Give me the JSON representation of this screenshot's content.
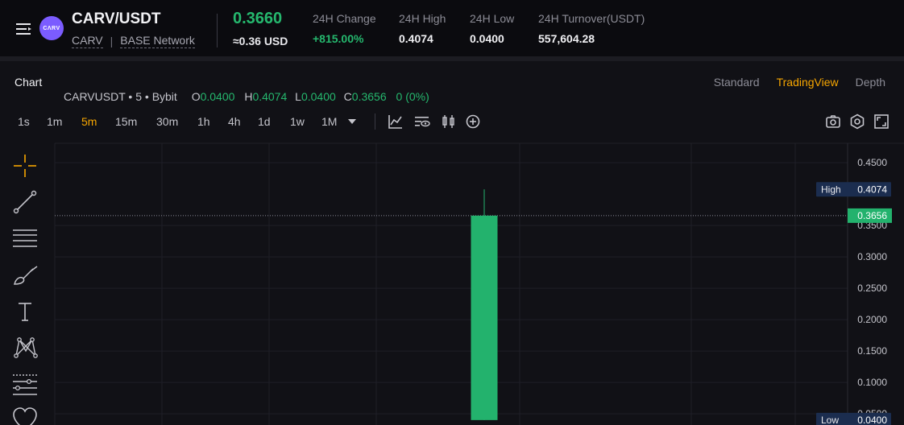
{
  "header": {
    "pair": "CARV/USDT",
    "coin_logo_text": "CΛRV",
    "base": "CARV",
    "network": "BASE Network",
    "last_price": "0.3660",
    "usd_price": "≈0.36 USD",
    "stats": [
      {
        "label": "24H Change",
        "value": "+815.00%",
        "positive": true
      },
      {
        "label": "24H High",
        "value": "0.4074"
      },
      {
        "label": "24H Low",
        "value": "0.0400"
      },
      {
        "label": "24H Turnover(USDT)",
        "value": "557,604.28"
      }
    ]
  },
  "panel": {
    "title": "Chart",
    "view_tabs": [
      "Standard",
      "TradingView",
      "Depth"
    ],
    "active_view": "TradingView"
  },
  "intervals": [
    "1s",
    "1m",
    "5m",
    "15m",
    "30m",
    "1h",
    "4h",
    "1d",
    "1w",
    "1M"
  ],
  "active_interval": "5m",
  "toolbar_icons": [
    "indicators-icon",
    "chart-type-icon",
    "candles-icon",
    "add-compare-icon",
    "camera-icon",
    "settings-icon",
    "fullscreen-icon"
  ],
  "drawing_tools": [
    "crosshair-icon",
    "trend-line-icon",
    "horizontal-lines-icon",
    "brush-icon",
    "text-icon",
    "pattern-icon",
    "measure-icon",
    "favorite-icon"
  ],
  "legend": {
    "symbol": "CARVUSDT",
    "dot1": "•",
    "interval": "5",
    "dot2": "•",
    "exchange": "Bybit",
    "o_label": "O",
    "o": "0.0400",
    "h_label": "H",
    "h": "0.4074",
    "l_label": "L",
    "l": "0.0400",
    "c_label": "C",
    "c": "0.3656",
    "change": "0 (0%)"
  },
  "chart_data": {
    "type": "bar",
    "subtype": "candlestick",
    "ylim": [
      0.036,
      0.46
    ],
    "y_ticks": [
      "0.4500",
      "0.3500",
      "0.3000",
      "0.2500",
      "0.2000",
      "0.1500",
      "0.1000",
      "0.0500"
    ],
    "y_tick_values": [
      0.45,
      0.35,
      0.3,
      0.25,
      0.2,
      0.15,
      0.1,
      0.05
    ],
    "candles": [
      {
        "open": 0.04,
        "high": 0.4074,
        "low": 0.04,
        "close": 0.3656
      }
    ],
    "price_tags": [
      {
        "label": "High",
        "value": "0.4074",
        "num": 0.4074,
        "kind": "high"
      },
      {
        "label": "",
        "value": "0.3656",
        "num": 0.3656,
        "kind": "last"
      },
      {
        "label": "Low",
        "value": "0.0400",
        "num": 0.04,
        "kind": "low"
      }
    ],
    "colors": {
      "up": "#23b26d",
      "tag": "#1b2d4f",
      "last": "#23b26d"
    }
  }
}
